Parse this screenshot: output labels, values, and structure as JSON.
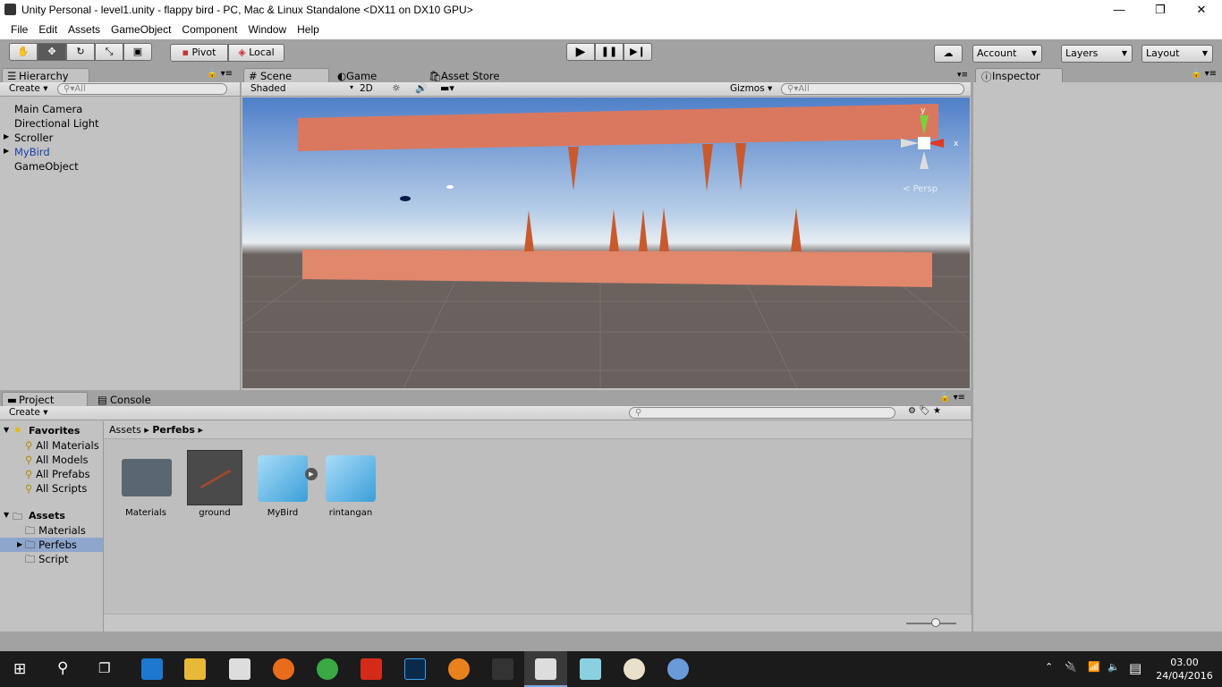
{
  "window": {
    "title": "Unity Personal - level1.unity - flappy bird - PC, Mac & Linux Standalone <DX11 on DX10 GPU>",
    "minimize": "—",
    "maximize": "❐",
    "close": "✕"
  },
  "menu": [
    "File",
    "Edit",
    "Assets",
    "GameObject",
    "Component",
    "Window",
    "Help"
  ],
  "toolbar": {
    "tools": [
      "hand-tool",
      "move-tool",
      "rotate-tool",
      "scale-tool",
      "rect-tool"
    ],
    "active_tool": "move-tool",
    "pivot": "Pivot",
    "local": "Local",
    "account": "Account",
    "layers": "Layers",
    "layout": "Layout"
  },
  "hierarchy": {
    "tab": "Hierarchy",
    "create": "Create",
    "search_placeholder": "All",
    "items": [
      {
        "label": "Main Camera",
        "expandable": false
      },
      {
        "label": "Directional Light",
        "expandable": false
      },
      {
        "label": "Scroller",
        "expandable": true
      },
      {
        "label": "MyBird",
        "expandable": true,
        "color": "#1a3ea8"
      },
      {
        "label": "GameObject",
        "expandable": false
      }
    ]
  },
  "scene": {
    "tabs": [
      "Scene",
      "Game",
      "Asset Store"
    ],
    "active_tab": "Scene",
    "shading": "Shaded",
    "mode_2d": "2D",
    "gizmos": "Gizmos",
    "search_placeholder": "All",
    "gizmo_y": "y",
    "gizmo_x": "x",
    "projection": "Persp"
  },
  "inspector": {
    "tab": "Inspector"
  },
  "project": {
    "tabs": [
      "Project",
      "Console"
    ],
    "create": "Create",
    "breadcrumb": [
      "Assets",
      "Perfebs"
    ],
    "favorites": {
      "label": "Favorites",
      "items": [
        "All Materials",
        "All Models",
        "All Prefabs",
        "All Scripts"
      ]
    },
    "assets": {
      "label": "Assets",
      "items": [
        "Materials",
        "Perfebs",
        "Script"
      ],
      "selected": "Perfebs"
    },
    "files": [
      {
        "name": "Materials",
        "type": "folder"
      },
      {
        "name": "ground",
        "type": "material"
      },
      {
        "name": "MyBird",
        "type": "prefab"
      },
      {
        "name": "rintangan",
        "type": "prefab"
      }
    ]
  },
  "taskbar": {
    "time": "03.00",
    "date": "24/04/2016"
  }
}
